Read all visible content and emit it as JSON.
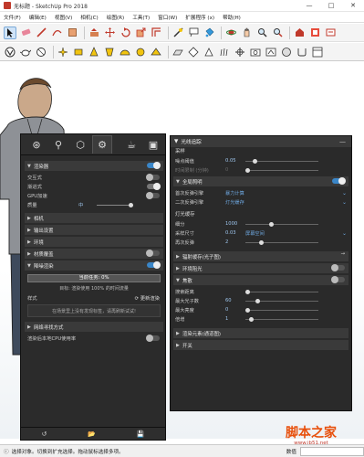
{
  "window": {
    "title": "无标题 - SketchUp Pro 2018",
    "controls": [
      "—",
      "□",
      "✕"
    ]
  },
  "menubar": {
    "items": [
      "文件(F)",
      "编辑(E)",
      "视图(V)",
      "相机(C)",
      "绘图(R)",
      "工具(T)",
      "窗口(W)",
      "扩展程序 (x)",
      "帮助(H)"
    ]
  },
  "toolbar1": {
    "icons": [
      "select-tool",
      "eraser-tool",
      "line-tool",
      "arc-tool",
      "shape-tool",
      "push-pull-tool",
      "move-tool",
      "rotate-tool",
      "scale-tool",
      "offset-tool",
      "tape-tool",
      "text-tool",
      "paint-tool",
      "orbit-tool",
      "pan-tool",
      "zoom-tool",
      "zoom-extents-tool",
      "warehouse-tool",
      "extension-tool",
      "layout-tool"
    ]
  },
  "toolbar2": {
    "icons": [
      "vray-logo",
      "teapot",
      "sphere",
      "light-omni",
      "light-rect",
      "light-spot",
      "light-ies",
      "light-dome",
      "light-sphere",
      "infinite-plane",
      "mesh-export",
      "proxy",
      "fur",
      "fireflies",
      "camera",
      "viewport",
      "material",
      "uv",
      "batch",
      "frame-buffer"
    ]
  },
  "left_panel": {
    "tabs": [
      "settings-tab",
      "light-tab",
      "cube-tab",
      "gear-tab"
    ],
    "sections": {
      "renderer": "渲染器",
      "interactive": "交互式",
      "progressive": "渐进式",
      "gpu": "GPU加速",
      "quality": "质量",
      "quality_value": "中",
      "camera": "相机",
      "output": "输出设置",
      "environment": "环境",
      "material_override": "材质覆盖",
      "denoise": "降噪渲染"
    },
    "progress": {
      "label": "当前任务: 0%",
      "fraction": 0
    },
    "progress_note": "目标: 渲染使用 100% 的时间流量",
    "swatch": {
      "label": "样式",
      "action": "更新渲染"
    },
    "empty_msg": "在场景里上没有发现标签，请再刷新试试!",
    "network": "网络寻找方式",
    "cpu_only": "渲染后本地CPU使用率",
    "bottom_icons": [
      "undo-icon",
      "open-icon",
      "save-icon"
    ]
  },
  "right_panel": {
    "header": "光线追踪",
    "sub": "采样",
    "rows1": [
      {
        "label": "噪点阈值",
        "value": "0.05",
        "pos": 0.1
      },
      {
        "label": "时间限制 (分钟)",
        "value": "0",
        "pos": 0.0,
        "dim": true
      }
    ],
    "gi_section": "全局照明",
    "gi_rows": [
      {
        "label": "首次反弹引擎",
        "value": "暴力计算"
      },
      {
        "label": "二次反弹引擎",
        "value": "灯光缓存"
      }
    ],
    "lc_sub": "灯光缓存",
    "lc_rows": [
      {
        "label": "细分",
        "value": "1000",
        "pos": 0.35
      },
      {
        "label": "采样尺寸",
        "value": "0.03",
        "extra": "屏幕空间"
      },
      {
        "label": "再次反弹",
        "value": "2",
        "pos": 0.2
      }
    ],
    "irradiance": "辐射缓存(光子图)",
    "ambient": "环境阻光",
    "caustics": "焦散",
    "caustic_rows": [
      {
        "label": "搜索距离",
        "value": "",
        "pos": 0.0
      },
      {
        "label": "最大光子数",
        "value": "60",
        "pos": 0.15
      },
      {
        "label": "最大亮度",
        "value": "0",
        "pos": 0.0
      },
      {
        "label": "倍增",
        "value": "1",
        "pos": 0.05
      }
    ],
    "render_elements": "渲染元素(通道图)",
    "switch": "开关"
  },
  "statusbar": {
    "text": "选择对象。切换到扩充选择。拖动鼠标选择多项。",
    "measure_label": "数值"
  },
  "watermark": {
    "title": "脚本之家",
    "url": "www.jb51.net"
  }
}
